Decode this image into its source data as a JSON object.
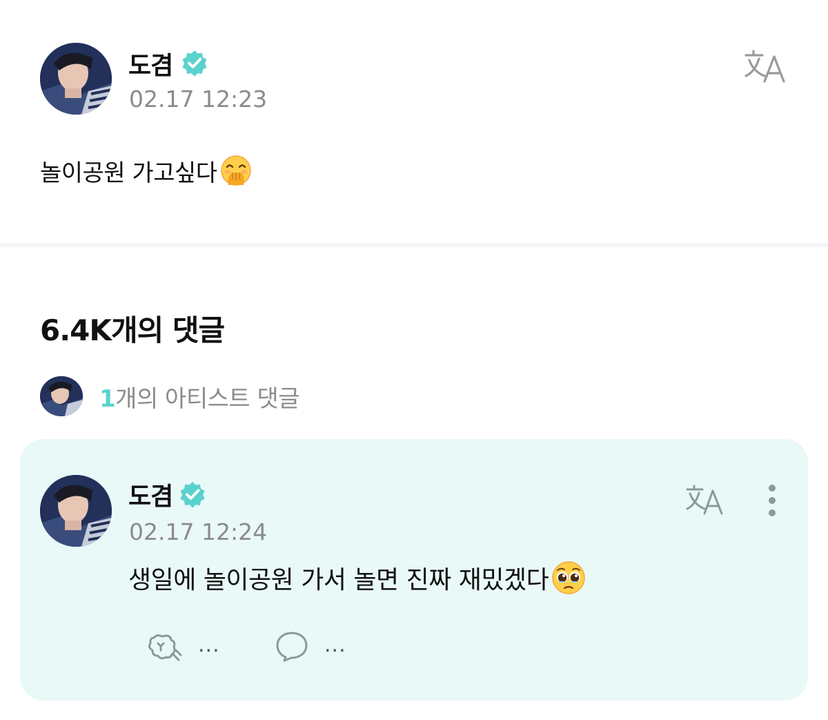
{
  "post": {
    "author": "도겸",
    "timestamp": "02.17 12:23",
    "text": "놀이공원 가고싶다",
    "emoji": "face-with-hand-over-mouth"
  },
  "comments": {
    "count_label": "6.4K개의 댓글",
    "artist_summary": {
      "count": "1",
      "label": "개의 아티스트 댓글"
    },
    "items": [
      {
        "author": "도겸",
        "timestamp": "02.17 12:24",
        "text": "생일에 놀이공원 가서 놀면 진짜 재밌겠다",
        "emoji": "pleading-face",
        "like_count": "...",
        "reply_count": "..."
      }
    ]
  },
  "colors": {
    "accent": "#5ad2cd",
    "card_bg": "#e9f9f7",
    "muted_text": "#8b8b8b",
    "icon_gray": "#8a9a98"
  },
  "icons": [
    "verified-badge-icon",
    "translate-icon",
    "more-icon",
    "like-icon",
    "reply-icon"
  ]
}
